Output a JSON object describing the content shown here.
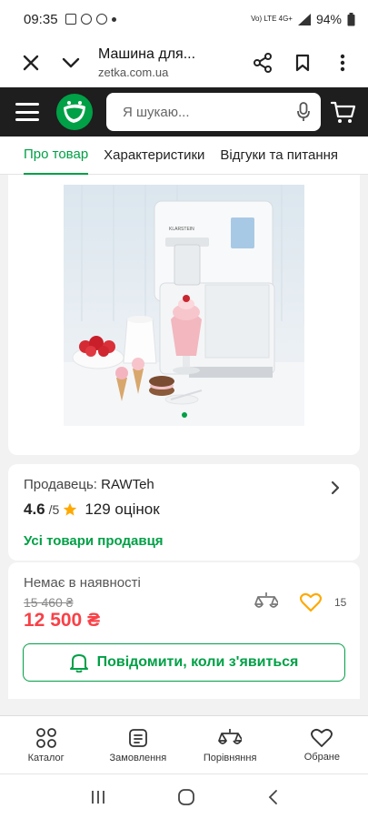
{
  "status_bar": {
    "time": "09:35",
    "network": "Vo) LTE 4G+",
    "battery": "94%"
  },
  "browser": {
    "page_title": "Машина для...",
    "url": "zetka.com.ua"
  },
  "search": {
    "placeholder": "Я шукаю..."
  },
  "tabs": [
    {
      "label": "Про товар",
      "active": true
    },
    {
      "label": "Характеристики",
      "active": false
    },
    {
      "label": "Відгуки та питання",
      "active": false
    }
  ],
  "seller": {
    "label": "Продавець:",
    "name": "RAWTeh",
    "rating": "4.6",
    "rating_of": "/5",
    "reviews": "129 оцінок",
    "all_goods_link": "Усі товари продавця"
  },
  "product": {
    "availability": "Немає в наявності",
    "old_price": "15 460 ₴",
    "price": "12 500 ₴",
    "favorites_count": "15",
    "notify_button": "Повідомити, коли з'явиться",
    "photo_brand_text": "KLARSTEIN"
  },
  "bottom_nav": [
    {
      "label": "Каталог",
      "icon": "catalog-icon"
    },
    {
      "label": "Замовлення",
      "icon": "orders-icon"
    },
    {
      "label": "Порівняння",
      "icon": "compare-icon"
    },
    {
      "label": "Обране",
      "icon": "heart-icon"
    }
  ],
  "colors": {
    "accent_green": "#00a046",
    "price_red": "#f84147",
    "header_dark": "#1e1e1e",
    "star": "#ffa900",
    "heart": "#ffa900"
  }
}
